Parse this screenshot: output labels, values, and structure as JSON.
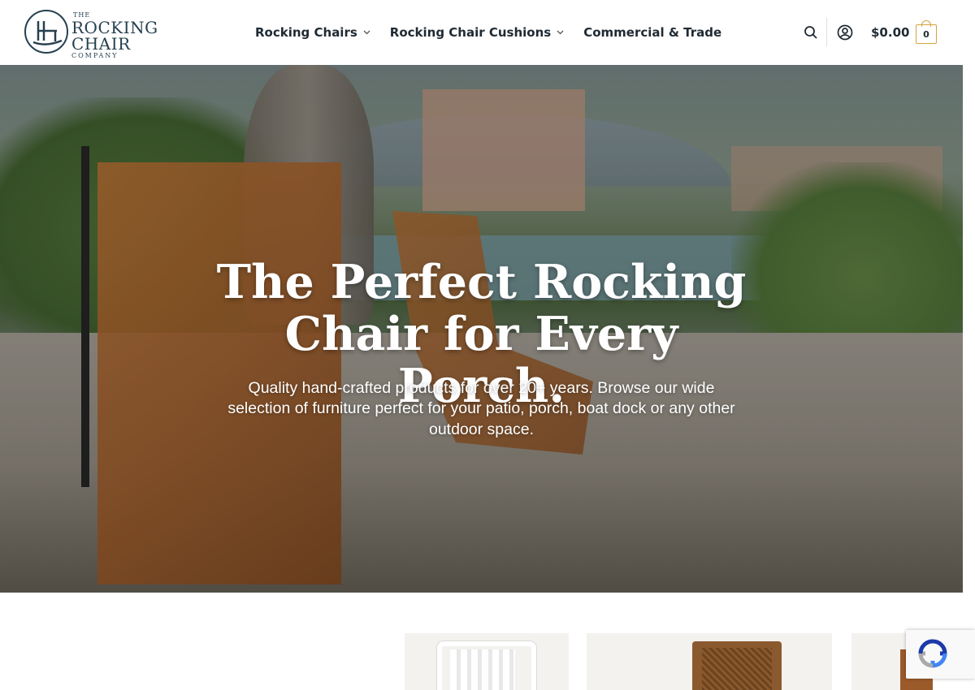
{
  "brand": {
    "the": "THE",
    "rocking": "ROCKING",
    "chair": "CHAIR",
    "company": "COMPANY",
    "color": "#26404f"
  },
  "nav": {
    "items": [
      {
        "label": "Rocking Chairs",
        "has_dropdown": true
      },
      {
        "label": "Rocking Chair Cushions",
        "has_dropdown": true
      },
      {
        "label": "Commercial & Trade",
        "has_dropdown": false
      }
    ]
  },
  "header": {
    "search_icon": "search-icon",
    "account_icon": "account-icon",
    "cart_total": "$0.00",
    "cart_count": "0",
    "accent_color": "#d4a340"
  },
  "hero": {
    "title_line1": "The Perfect Rocking",
    "title_line2": "Chair for Every Porch.",
    "subtitle": "Quality hand-crafted products for over 20+ years. Browse our wide selection of furniture perfect for your patio, porch, boat dock or any other outdoor space."
  },
  "recaptcha": {
    "icon": "recaptcha-icon"
  }
}
